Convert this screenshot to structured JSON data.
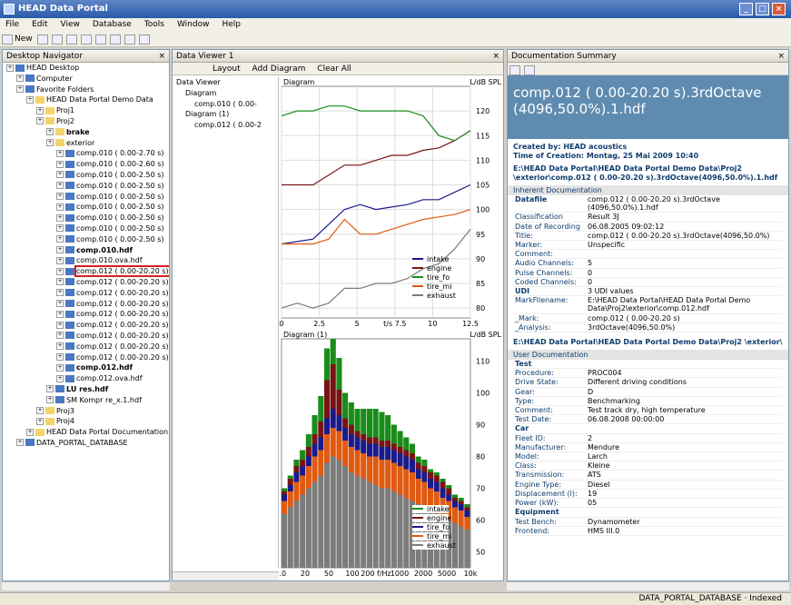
{
  "app": {
    "title": "HEAD Data Portal"
  },
  "menu": [
    "File",
    "Edit",
    "View",
    "Database",
    "Tools",
    "Window",
    "Help"
  ],
  "toolbar": {
    "new_label": "New"
  },
  "nav": {
    "title": "Desktop Navigator",
    "items": [
      {
        "label": "HEAD Desktop",
        "depth": 0,
        "icon": "desktop"
      },
      {
        "label": "Computer",
        "depth": 1,
        "icon": "computer"
      },
      {
        "label": "Favorite Folders",
        "depth": 1,
        "icon": "star"
      },
      {
        "label": "HEAD Data Portal Demo Data",
        "depth": 2,
        "icon": "folder"
      },
      {
        "label": "Proj1",
        "depth": 3,
        "icon": "folder"
      },
      {
        "label": "Proj2",
        "depth": 3,
        "icon": "folder"
      },
      {
        "label": "brake",
        "depth": 4,
        "icon": "folder",
        "bold": true
      },
      {
        "label": "exterior",
        "depth": 4,
        "icon": "folder"
      },
      {
        "label": "comp.010 ( 0.00-2.70 s)",
        "depth": 5,
        "icon": "file"
      },
      {
        "label": "comp.010 ( 0.00-2.60 s)",
        "depth": 5,
        "icon": "file"
      },
      {
        "label": "comp.010 ( 0.00-2.50 s)",
        "depth": 5,
        "icon": "file"
      },
      {
        "label": "comp.010 ( 0.00-2.50 s)",
        "depth": 5,
        "icon": "file"
      },
      {
        "label": "comp.010 ( 0.00-2.50 s)",
        "depth": 5,
        "icon": "file"
      },
      {
        "label": "comp.010 ( 0.00-2.50 s)",
        "depth": 5,
        "icon": "file"
      },
      {
        "label": "comp.010 ( 0.00-2.50 s)",
        "depth": 5,
        "icon": "file"
      },
      {
        "label": "comp.010 ( 0.00-2.50 s)",
        "depth": 5,
        "icon": "file"
      },
      {
        "label": "comp.010 ( 0.00-2.50 s)",
        "depth": 5,
        "icon": "file"
      },
      {
        "label": "comp.010.hdf",
        "depth": 5,
        "icon": "file",
        "bold": true
      },
      {
        "label": "comp.010.ova.hdf",
        "depth": 5,
        "icon": "file"
      },
      {
        "label": "comp.012 ( 0.00-20.20 s)",
        "depth": 5,
        "icon": "file",
        "selected": true
      },
      {
        "label": "comp.012 ( 0.00-20.20 s)",
        "depth": 5,
        "icon": "file"
      },
      {
        "label": "comp.012 ( 0.00-20.20 s)",
        "depth": 5,
        "icon": "file"
      },
      {
        "label": "comp.012 ( 0.00-20.20 s)",
        "depth": 5,
        "icon": "file"
      },
      {
        "label": "comp.012 ( 0.00-20.20 s)",
        "depth": 5,
        "icon": "file"
      },
      {
        "label": "comp.012 ( 0.00-20.20 s)",
        "depth": 5,
        "icon": "file"
      },
      {
        "label": "comp.012 ( 0.00-20.20 s)",
        "depth": 5,
        "icon": "file"
      },
      {
        "label": "comp.012 ( 0.00-20.20 s)",
        "depth": 5,
        "icon": "file"
      },
      {
        "label": "comp.012 ( 0.00-20.20 s)",
        "depth": 5,
        "icon": "file"
      },
      {
        "label": "comp.012.hdf",
        "depth": 5,
        "icon": "file",
        "bold": true
      },
      {
        "label": "comp.012.ova.hdf",
        "depth": 5,
        "icon": "file"
      },
      {
        "label": "LU res.hdf",
        "depth": 4,
        "icon": "file",
        "bold": true
      },
      {
        "label": "SM Kompr re_x.1.hdf",
        "depth": 4,
        "icon": "file"
      },
      {
        "label": "Proj3",
        "depth": 3,
        "icon": "folder"
      },
      {
        "label": "Proj4",
        "depth": 3,
        "icon": "folder"
      },
      {
        "label": "HEAD Data Portal Documentation",
        "depth": 2,
        "icon": "folder"
      },
      {
        "label": "DATA_PORTAL_DATABASE",
        "depth": 1,
        "icon": "db"
      }
    ]
  },
  "viewer": {
    "title": "Data Viewer 1",
    "layout_label": "Layout",
    "add_diagram_label": "Add Diagram",
    "clear_all_label": "Clear All",
    "tree": [
      {
        "label": "Data Viewer",
        "depth": 0
      },
      {
        "label": "Diagram",
        "depth": 1
      },
      {
        "label": "comp.010 ( 0.00-",
        "depth": 2
      },
      {
        "label": "Diagram (1)",
        "depth": 1
      },
      {
        "label": "comp.012 ( 0.00-2",
        "depth": 2
      }
    ],
    "diagram1_title": "Diagram",
    "diagram2_title": "Diagram (1)",
    "unit_label": "L/dB SPL"
  },
  "chart_data": [
    {
      "type": "line",
      "title": "Diagram",
      "ylabel": "L/dB SPL",
      "x_ticks": [
        "0",
        "2.5",
        "5",
        "t/s 7.5",
        "10",
        "12.5"
      ],
      "y_ticks": [
        "80",
        "85",
        "90",
        "95",
        "100",
        "105",
        "110",
        "115",
        "120"
      ],
      "ylim": [
        78,
        125
      ],
      "xlim": [
        0,
        12.5
      ],
      "series": [
        {
          "name": "intake",
          "color": "#1a1a8c",
          "values": [
            93,
            93.5,
            94,
            97,
            100,
            101,
            100,
            100.5,
            101,
            102,
            102,
            103.5,
            105
          ]
        },
        {
          "name": "engine",
          "color": "#7a1414",
          "values": [
            105,
            105,
            105,
            107,
            109,
            109,
            110,
            111,
            111,
            112,
            112.5,
            114,
            116
          ]
        },
        {
          "name": "tire_fo",
          "color": "#1a8c1a",
          "values": [
            119,
            120,
            120,
            121,
            121,
            120,
            120,
            120,
            120,
            119,
            115,
            114,
            116
          ]
        },
        {
          "name": "tire_mi",
          "color": "#e05a10",
          "values": [
            93,
            93,
            93,
            94,
            98,
            95,
            95,
            96,
            97,
            98,
            98.5,
            99,
            100
          ]
        },
        {
          "name": "exhaust",
          "color": "#7c7c7c",
          "values": [
            80,
            81,
            80,
            81,
            84,
            84,
            85,
            85,
            86,
            88,
            89,
            92,
            96
          ]
        }
      ],
      "legend": "bottom-right"
    },
    {
      "type": "bar",
      "title": "Diagram (1)",
      "ylabel": "L/dB SPL",
      "x_ticks": [
        "10",
        "20",
        "50",
        "100",
        "200 f/Hz",
        "1000",
        "2000",
        "5000",
        "10k"
      ],
      "y_ticks": [
        "50",
        "60",
        "70",
        "80",
        "90",
        "100",
        "110"
      ],
      "ylim": [
        45,
        117
      ],
      "categories": 31,
      "series": [
        {
          "name": "exhaust",
          "color": "#7c7c7c",
          "values": [
            62,
            64,
            66,
            68,
            70,
            72,
            74,
            78,
            80,
            79,
            77,
            75,
            74,
            73,
            72,
            71,
            70,
            70,
            69,
            68,
            67,
            66,
            65,
            64,
            63,
            62,
            61,
            60,
            59,
            58,
            57
          ]
        },
        {
          "name": "tire_mi",
          "color": "#e05a10",
          "values": [
            4,
            5,
            6,
            6,
            7,
            8,
            8,
            9,
            9,
            9,
            8,
            8,
            8,
            8,
            8,
            9,
            9,
            9,
            9,
            9,
            9,
            9,
            8,
            8,
            7,
            7,
            6,
            6,
            5,
            5,
            4
          ]
        },
        {
          "name": "tire_fo",
          "color": "#1a1a8c",
          "values": [
            2,
            2,
            3,
            3,
            3,
            4,
            4,
            5,
            6,
            5,
            4,
            4,
            4,
            4,
            4,
            4,
            4,
            4,
            4,
            4,
            4,
            4,
            3,
            3,
            3,
            3,
            3,
            2,
            2,
            2,
            2
          ]
        },
        {
          "name": "engine",
          "color": "#7a1414",
          "values": [
            1,
            2,
            2,
            2,
            3,
            3,
            5,
            12,
            14,
            8,
            3,
            3,
            2,
            2,
            2,
            2,
            2,
            2,
            2,
            2,
            2,
            2,
            2,
            2,
            2,
            2,
            2,
            2,
            1,
            1,
            1
          ]
        },
        {
          "name": "intake",
          "color": "#1a8c1a",
          "values": [
            1,
            1,
            2,
            3,
            4,
            6,
            8,
            10,
            12,
            10,
            8,
            7,
            7,
            8,
            9,
            9,
            9,
            8,
            6,
            5,
            4,
            3,
            2,
            2,
            1,
            1,
            1,
            1,
            1,
            1,
            1
          ]
        }
      ],
      "legend": "bottom-right"
    }
  ],
  "doc": {
    "title": "Documentation Summary",
    "banner": "comp.012 ( 0.00-20.20 s).3rdOctave (4096,50.0%).1.hdf",
    "created_by": "Created by: HEAD acoustics",
    "time": "Time of Creation: Montag, 25 Mai 2009 10:40",
    "path1": "E:\\HEAD Data Portal\\HEAD Data Portal Demo Data\\Proj2 \\exterior\\comp.012 ( 0.00-20.20 s).3rdOctave(4096,50.0%).1.hdf",
    "inherent_title": "Inherent Documentation",
    "inherent": [
      [
        "Datafile",
        "comp.012 ( 0.00-20.20 s).3rdOctave (4096,50.0%).1.hdf",
        true
      ],
      [
        "Classification",
        "Result 3J",
        false
      ],
      [
        "Date of Recording",
        "06.08.2005 09:02:12",
        false
      ],
      [
        "Title:",
        "comp.012 ( 0.00-20.20 s).3rdOctave(4096,50.0%)",
        false
      ],
      [
        "Marker:",
        "Unspecific",
        false
      ],
      [
        "Comment:",
        "",
        false
      ],
      [
        "Audio Channels:",
        "5",
        false
      ],
      [
        "Pulse Channels:",
        "0",
        false
      ],
      [
        "Coded Channels:",
        "0",
        false
      ],
      [
        "UDI",
        "3 UDI values",
        true
      ],
      [
        "MarkFilename:",
        "E:\\HEAD Data Portal\\HEAD Data Portal Demo Data\\Proj2\\exterior\\comp.012.hdf",
        false
      ],
      [
        "_Mark:",
        "comp.012 ( 0.00-20.20 s)",
        false
      ],
      [
        "_Analysis:",
        "3rdOctave(4096,50.0%)",
        false
      ]
    ],
    "path2": "E:\\HEAD Data Portal\\HEAD Data Portal Demo Data\\Proj2 \\exterior\\",
    "user_title": "User Documentation",
    "user": [
      [
        "Test",
        "",
        true
      ],
      [
        "Procedure:",
        "PROC004",
        false
      ],
      [
        "Drive State:",
        "Different driving conditions",
        false
      ],
      [
        "Gear:",
        "D",
        false
      ],
      [
        "Type:",
        "Benchmarking",
        false
      ],
      [
        "Comment:",
        "Test track dry, high temperature",
        false
      ],
      [
        "Test Date:",
        "06.08.2008 00:00:00",
        false
      ],
      [
        "Car",
        "",
        true
      ],
      [
        "Fleet ID:",
        "2",
        false
      ],
      [
        "Manufacturer:",
        "Mendure",
        false
      ],
      [
        "Model:",
        "Larch",
        false
      ],
      [
        "Class:",
        "Kleine",
        false
      ],
      [
        "Transmission:",
        "ATS",
        false
      ],
      [
        "Engine Type:",
        "Diesel",
        false
      ],
      [
        "Displacement (l):",
        "19",
        false
      ],
      [
        "Power (kW):",
        "05",
        false
      ],
      [
        "Equipment",
        "",
        true
      ],
      [
        "Test Bench:",
        "Dynamometer",
        false
      ],
      [
        "Frontend:",
        "HMS III.0",
        false
      ]
    ]
  },
  "status": {
    "database": "DATA_PORTAL_DATABASE",
    "indexed": "Indexed"
  }
}
